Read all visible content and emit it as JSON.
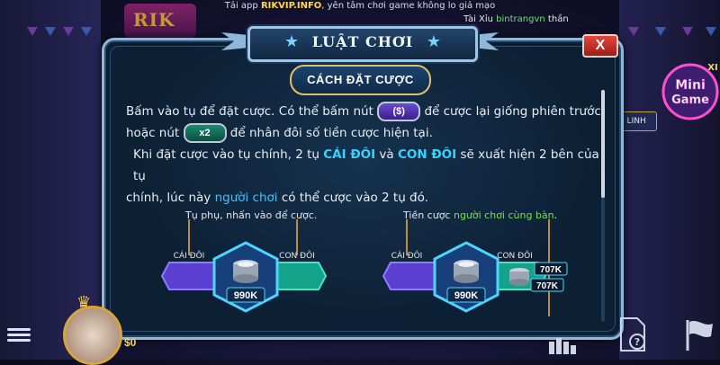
{
  "top_bar": {
    "prefix": "Tải app ",
    "site": "RIKVIP.INFO",
    "suffix": ", yên tâm chơi game không lo giả mạo"
  },
  "ticker": {
    "prefix": "Tài Xỉu ",
    "user": "bintrangvn",
    "suffix": " thần"
  },
  "logo": {
    "text": "RIK"
  },
  "modal": {
    "title": "LUẬT CHƠI",
    "close_label": "X",
    "section_title": "CÁCH ĐẶT CƯỢC",
    "para1": {
      "a": "Bấm vào tụ để đặt cược. Có thể bấm nút ",
      "btn_rebet": "($)",
      "b": " để cược lại giống phiên trước",
      "c": "hoặc nút ",
      "btn_x2": "x2",
      "d": " để nhân đôi số tiền cược hiện tại."
    },
    "para2": {
      "a": "Khi đặt cược vào tụ chính, 2 tụ ",
      "cai_doi": "CÁI ĐÔI",
      "b": " và ",
      "con_doi": "CON ĐÔI",
      "c": " sẽ xuất hiện 2 bên của tụ",
      "d": "chính, lúc này ",
      "player": "người chơi",
      "e": " có thể cược vào 2 tụ đó."
    },
    "figure_left": {
      "caption": "Tụ phụ, nhấn vào để cược.",
      "left_label": "CÁI ĐÔI",
      "right_label": "CON ĐÔI",
      "amount": "990K"
    },
    "figure_right": {
      "caption_a": "Tiền cược ",
      "caption_b": "người chơi cùng bàn",
      "caption_c": ".",
      "left_label": "CÁI ĐÔI",
      "right_label": "CON ĐÔI",
      "amount": "990K",
      "bet1": "707K",
      "bet2": "707K"
    }
  },
  "side": {
    "label": "SỬ LINH",
    "mini_game": "Mini Game",
    "mini_game_prefix": "XI"
  },
  "bottom": {
    "balance": "$0"
  },
  "colors": {
    "accent_cyan": "#31d6ff",
    "link": "#3fc3ff",
    "green": "#7be04a",
    "gold": "#ffd54a"
  }
}
